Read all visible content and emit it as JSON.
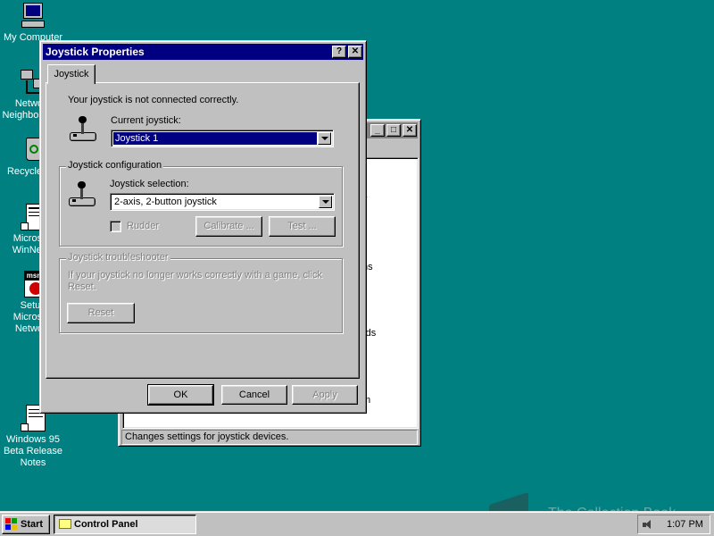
{
  "desktop": {
    "icons": [
      {
        "label": "My Computer",
        "icon": "computer-icon"
      },
      {
        "label": "Network\nNeighborhood",
        "icon": "network-icon"
      },
      {
        "label": "Recycle Bin",
        "icon": "recycle-bin-icon"
      },
      {
        "label": "Microsoft\nWinNews",
        "icon": "document-shortcut-icon"
      },
      {
        "label": "Setup\nMicrosoft\nNetwork",
        "icon": "msn-icon"
      },
      {
        "label": "Windows 95\nBeta Release\nNotes",
        "icon": "notes-icon"
      }
    ]
  },
  "control_panel": {
    "status": "Changes settings for joystick devices.",
    "items": [
      "y",
      "ns",
      "rds",
      "m"
    ]
  },
  "dialog": {
    "title": "Joystick Properties",
    "tab": "Joystick",
    "status_text": "Your joystick is not connected correctly.",
    "current_label": "Current joystick:",
    "current_value": "Joystick 1",
    "config_group": "Joystick configuration",
    "selection_label": "Joystick selection:",
    "selection_value": "2-axis, 2-button joystick",
    "rudder_label": "Rudder",
    "calibrate_label": "Calibrate ...",
    "test_label": "Test ...",
    "troubleshooter_group": "Joystick troubleshooter",
    "troubleshooter_text": "If your joystick no longer works correctly with a game, click Reset.",
    "reset_label": "Reset",
    "ok_label": "OK",
    "cancel_label": "Cancel",
    "apply_label": "Apply",
    "help_btn": "?",
    "close_btn": "✕"
  },
  "taskbar": {
    "start_label": "Start",
    "task_label": "Control Panel",
    "clock": "1:07 PM"
  },
  "watermark": "The Collection Book"
}
